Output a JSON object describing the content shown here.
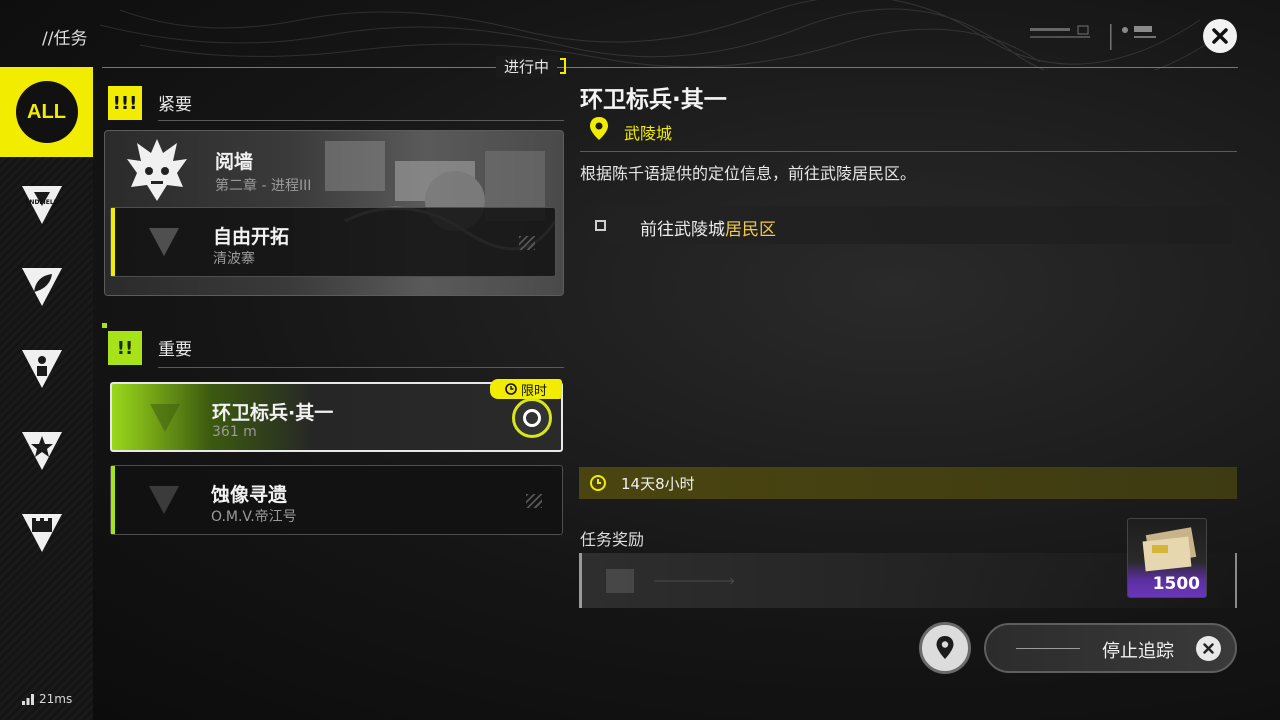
{
  "header": {
    "title": "//任务"
  },
  "sidebar": {
    "items": [
      {
        "label": "ALL",
        "icon": "all-icon",
        "active": true
      },
      {
        "label": "ENDFIELD",
        "icon": "endfield-icon"
      },
      {
        "label": "",
        "icon": "leaf-icon"
      },
      {
        "label": "",
        "icon": "person-icon"
      },
      {
        "label": "",
        "icon": "star-icon"
      },
      {
        "label": "",
        "icon": "castle-icon"
      }
    ]
  },
  "list": {
    "in_progress": "进行中",
    "urgent": {
      "badge": "!!!",
      "label": "紧要",
      "featured": {
        "title": "阅墙",
        "subtitle": "第二章 - 进程III"
      },
      "cards": [
        {
          "title": "自由开拓",
          "subtitle": "清波寨"
        }
      ]
    },
    "important": {
      "badge": "!!",
      "label": "重要",
      "cards": [
        {
          "title": "环卫标兵·其一",
          "subtitle": "361 m",
          "tag": "限时",
          "selected": true
        },
        {
          "title": "蚀像寻遗",
          "subtitle": "O.M.V.帝江号"
        }
      ]
    }
  },
  "detail": {
    "title": "环卫标兵·其一",
    "location": "武陵城",
    "description": "根据陈千语提供的定位信息，前往武陵居民区。",
    "objective": {
      "prefix": "前往武陵城",
      "highlight": "居民区"
    },
    "timer": "14天8小时",
    "reward_label": "任务奖励",
    "reward_qty": "1500"
  },
  "actions": {
    "stop_tracking": "停止追踪"
  },
  "status": {
    "ping": "21ms"
  },
  "colors": {
    "accent": "#f2ec00",
    "important": "#a8e31a",
    "reward_rarity": "#6a36b8"
  }
}
